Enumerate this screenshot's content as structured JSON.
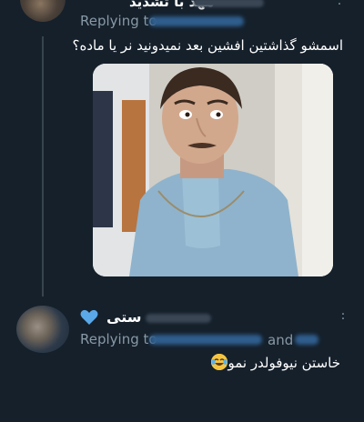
{
  "tweet1": {
    "display_name": "مهد با تشدید",
    "replying_to_label": "Replying to",
    "text": "اسمشو گذاشتین افشین بعد نمیدونید نر یا ماده؟",
    "menu_icon": "more-vertical-icon"
  },
  "tweet2": {
    "display_name": "ستی",
    "name_emoji": "blue-heart-icon",
    "replying_to_label": "Replying to",
    "and_label": "and",
    "text": "خاستن نیوفولدر نمونه",
    "text_emoji": "tears-of-joy-icon",
    "menu_icon": "more-vertical-icon"
  },
  "colors": {
    "background": "#15202b",
    "text_primary": "#ffffff",
    "text_secondary": "#8899a6",
    "thread_line": "#38444d",
    "heart": "#5aa8e8"
  }
}
